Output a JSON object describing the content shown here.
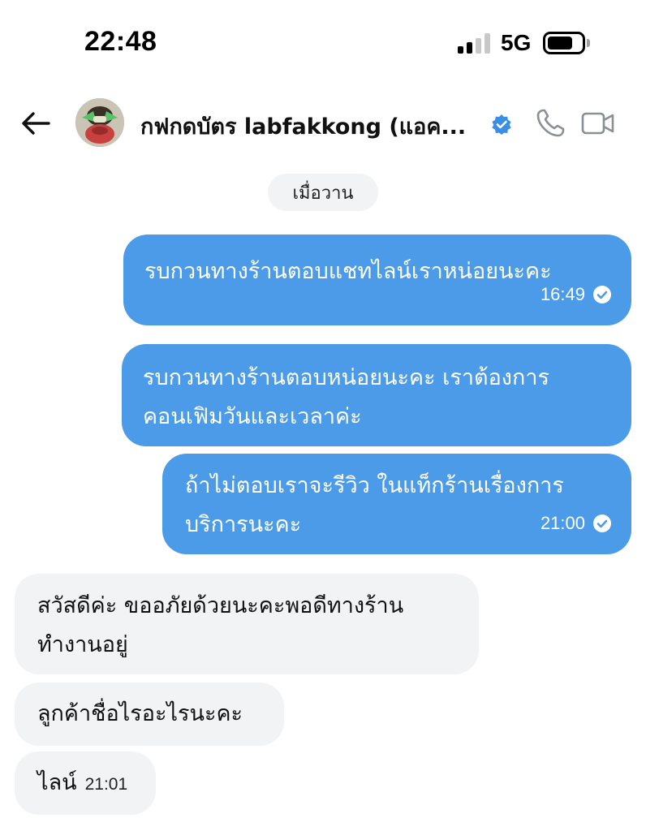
{
  "status_bar": {
    "time": "22:48",
    "network": "5G",
    "signal_bars_active": 2,
    "signal_bars_total": 4,
    "battery_level": 0.6
  },
  "header": {
    "contact_name": "กฟกดบัตร labfakkong (แอค...",
    "verified": true,
    "icons": {
      "back": "arrow-left-icon",
      "verified": "verified-badge-icon",
      "call": "phone-icon",
      "video": "video-camera-icon"
    }
  },
  "date_separator": "เมื่อวาน",
  "messages": [
    {
      "direction": "outgoing",
      "text": "รบกวนทางร้านตอบแชทไลน์เราหน่อยนะคะ",
      "time": "16:49",
      "read": true
    },
    {
      "direction": "outgoing",
      "line1": "รบกวนทางร้านตอบหน่อยนะคะ เราต้องการ",
      "line2": "คอนเฟิมวันและเวลาค่ะ"
    },
    {
      "direction": "outgoing",
      "line1": "ถ้าไม่ตอบเราจะรีวิว ในแท็กร้านเรื่องการ",
      "line2": "บริการนะคะ",
      "time": "21:00",
      "read": true
    },
    {
      "direction": "incoming",
      "line1": "สวัสดีค่ะ ขออภัยด้วยนะคะพอดีทางร้าน",
      "line2": "ทำงานอยู่"
    },
    {
      "direction": "incoming",
      "text": "ลูกค้าชื่อไรอะไรนะคะ"
    },
    {
      "direction": "incoming",
      "text": "ไลน์",
      "time": "21:01"
    }
  ],
  "colors": {
    "outgoing_bubble": "#4b9be8",
    "incoming_bubble": "#f2f3f5",
    "verified_badge": "#3b8ee6",
    "icon_gray": "#8a8f96"
  }
}
